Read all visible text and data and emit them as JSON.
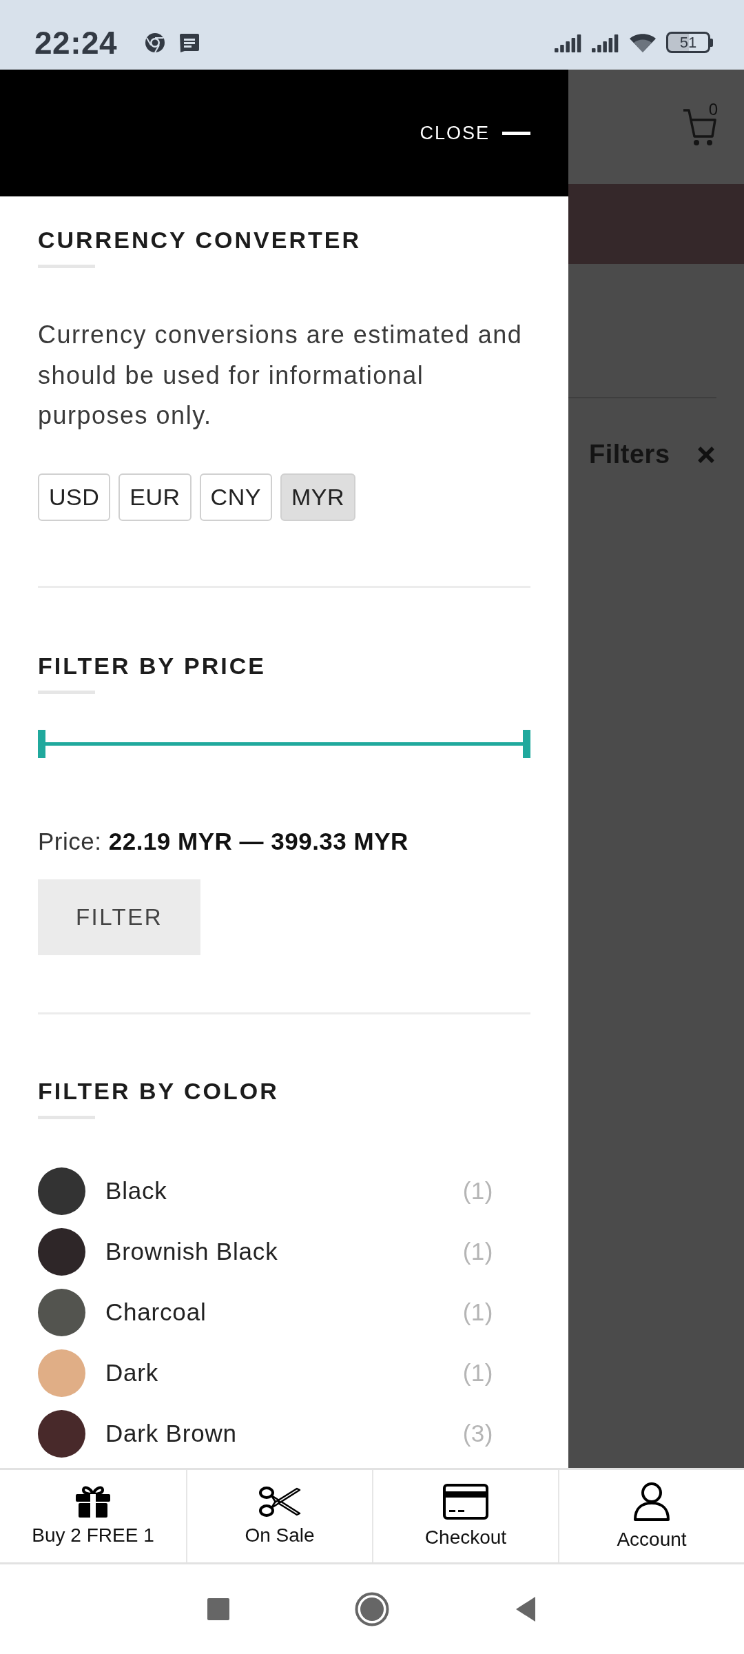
{
  "status_bar": {
    "time": "22:24",
    "battery": "51"
  },
  "drawer": {
    "close_label": "CLOSE",
    "currency_converter": {
      "title": "CURRENCY CONVERTER",
      "description": "Currency conversions are estimated and should be used for informational purposes only.",
      "currencies": [
        {
          "label": "USD",
          "selected": false
        },
        {
          "label": "EUR",
          "selected": false
        },
        {
          "label": "CNY",
          "selected": false
        },
        {
          "label": "MYR",
          "selected": true
        }
      ]
    },
    "price_filter": {
      "title": "FILTER BY PRICE",
      "handles": [
        {
          "level": 0
        },
        {
          "level": 1
        }
      ],
      "price_text": "Price: **22.19 MYR — 399.33 MYR**",
      "button": "FILTER"
    },
    "color_filter": {
      "title": "FILTER BY COLOR",
      "colors": [
        {
          "name": "Black",
          "count": "(1)",
          "color": "#333333"
        },
        {
          "name": "Brownish Black",
          "count": "(1)",
          "color": "#2e2628"
        },
        {
          "name": "Charcoal",
          "count": "(1)",
          "color": "#53544f"
        },
        {
          "name": "Dark",
          "count": "(1)",
          "color": "#e0ae86"
        },
        {
          "name": "Dark Brown",
          "count": "(3)",
          "color": "#48292a"
        }
      ]
    }
  },
  "background_page": {
    "cart_count": "0",
    "filters_title": "Filters"
  },
  "bottom_nav": [
    {
      "kind": "gift",
      "label": "Buy 2 FREE 1"
    },
    {
      "kind": "scissors",
      "label": "On Sale"
    },
    {
      "kind": "card",
      "label": "Checkout"
    },
    {
      "kind": "person",
      "label": "Account"
    }
  ]
}
